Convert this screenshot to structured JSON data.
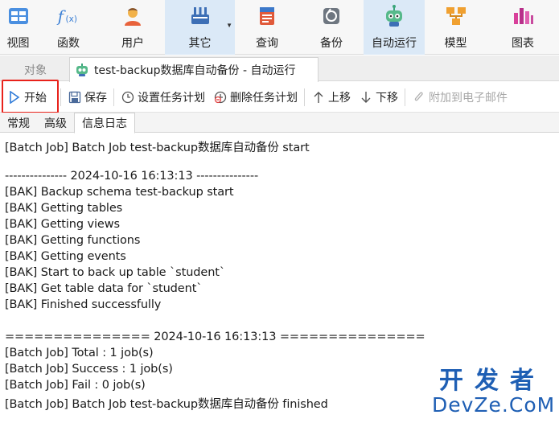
{
  "ribbon": {
    "items": [
      {
        "label": "视图",
        "icon": "view-icon"
      },
      {
        "label": "函数",
        "icon": "function-icon"
      },
      {
        "label": "用户",
        "icon": "user-icon"
      },
      {
        "label": "其它",
        "icon": "tools-icon"
      },
      {
        "label": "查询",
        "icon": "query-icon"
      },
      {
        "label": "备份",
        "icon": "backup-icon"
      },
      {
        "label": "自动运行",
        "icon": "robot-icon"
      },
      {
        "label": "模型",
        "icon": "model-icon"
      },
      {
        "label": "图表",
        "icon": "chart-icon"
      }
    ],
    "active": "自动运行"
  },
  "tabs": {
    "objects_label": "对象",
    "active_tab_label": "test-backup数据库自动备份 - 自动运行"
  },
  "toolbar": {
    "start_label": "开始",
    "save_label": "保存",
    "set_schedule_label": "设置任务计划",
    "delete_schedule_label": "删除任务计划",
    "move_up_label": "上移",
    "move_down_label": "下移",
    "attach_email_label": "附加到电子邮件"
  },
  "subtabs": {
    "general_label": "常规",
    "advanced_label": "高级",
    "log_label": "信息日志"
  },
  "log": {
    "lines": [
      "[Batch Job] Batch Job test-backup数据库自动备份 start",
      "",
      "--------------- 2024-10-16 16:13:13 ---------------",
      "[BAK] Backup schema test-backup start",
      "[BAK] Getting tables",
      "[BAK] Getting views",
      "[BAK] Getting functions",
      "[BAK] Getting events",
      "[BAK] Start to back up table `student`",
      "[BAK] Get table data for `student`",
      "[BAK] Finished successfully",
      "",
      "=============== 2024-10-16 16:13:13 ===============",
      "[Batch Job] Total : 1 job(s)",
      "[Batch Job] Success : 1 job(s)",
      "[Batch Job] Fail : 0 job(s)",
      "[Batch Job] Batch Job test-backup数据库自动备份 finished"
    ]
  },
  "watermark": {
    "cn": "开发者",
    "en": "DevZe.CoM"
  },
  "colors": {
    "highlight_box": "#e8221b",
    "active_ribbon": "#dbe9f7",
    "watermark": "#1f5fb4"
  }
}
